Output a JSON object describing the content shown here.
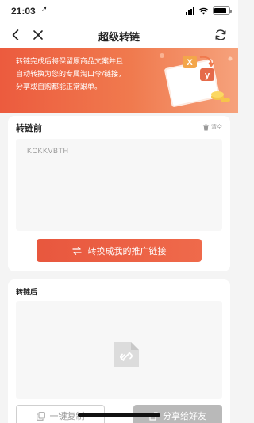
{
  "status_bar": {
    "time": "21:03",
    "location_glyph": "➚",
    "battery_level": 0.85
  },
  "nav": {
    "title": "超级转链",
    "icons": [
      "back-icon",
      "close-icon",
      "refresh-icon"
    ]
  },
  "banner": {
    "lines": [
      "转链完成后将保留原商品文案并且",
      "自动转换为您的专属淘口令/链接，",
      "分享或自购都能正常跟单。"
    ],
    "art_labels": {
      "x_badge": "X",
      "y_badge": "y"
    }
  },
  "before": {
    "title": "转链前",
    "clear_label": "清空",
    "input_value": "KCKKVBTH",
    "convert_label": "转换成我的推广链接"
  },
  "after": {
    "title": "转链后",
    "copy_label": "一键复制",
    "share_label": "分享给好友"
  },
  "colors": {
    "accent": "#e8573e",
    "banner_start": "#ec5b3e",
    "banner_end": "#f6a27c",
    "disabled": "#b9b9b9"
  }
}
